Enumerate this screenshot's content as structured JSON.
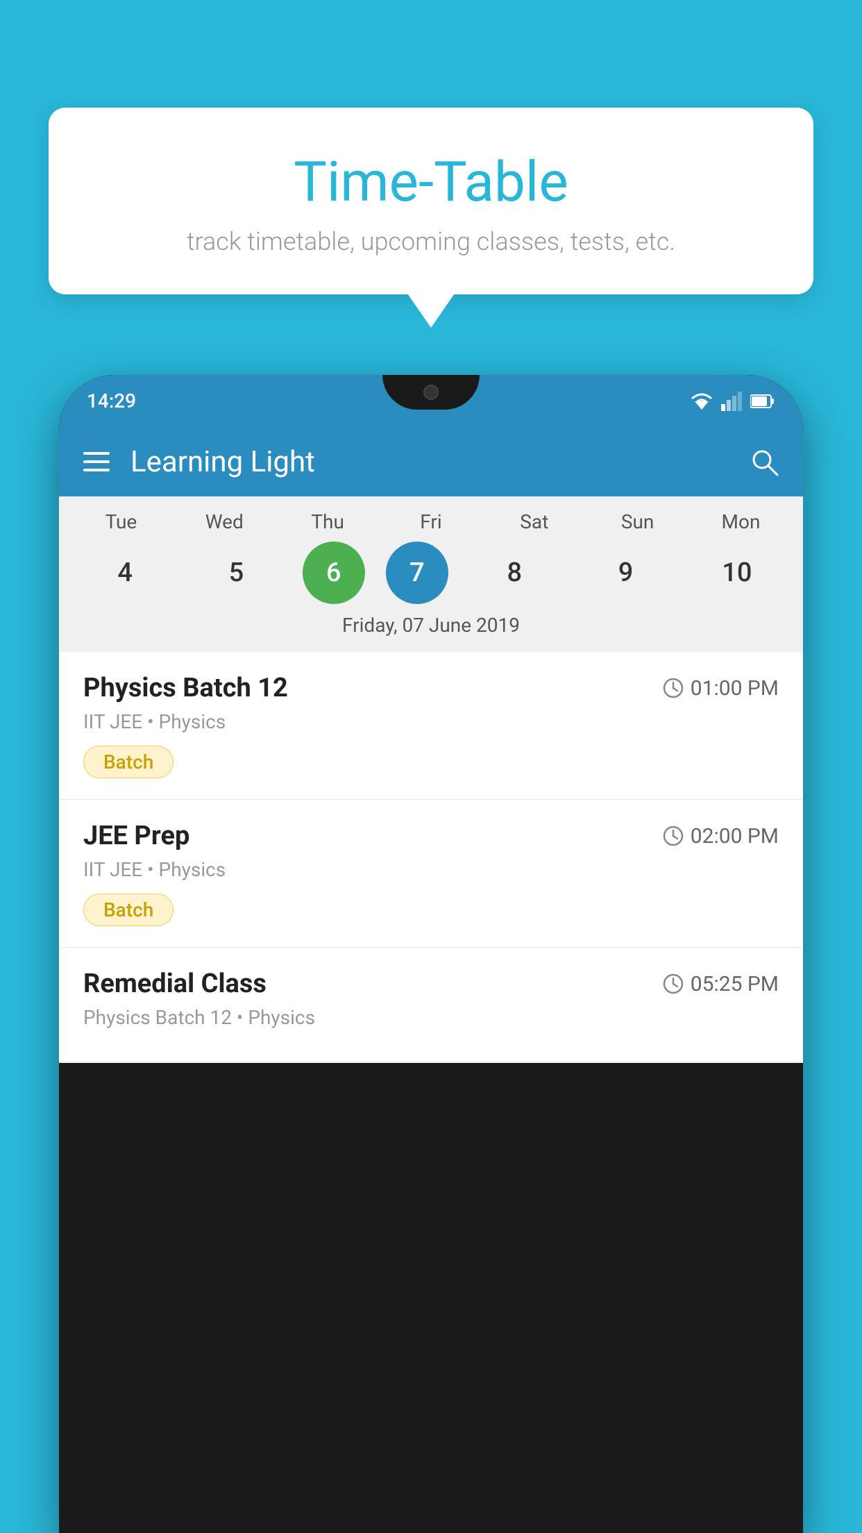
{
  "background": {
    "color": "#29b6d8"
  },
  "bubble": {
    "title": "Time-Table",
    "subtitle": "track timetable, upcoming classes, tests, etc."
  },
  "phone": {
    "status_bar": {
      "time": "14:29"
    },
    "app_bar": {
      "title": "Learning Light"
    },
    "calendar": {
      "days": [
        "Tue",
        "Wed",
        "Thu",
        "Fri",
        "Sat",
        "Sun",
        "Mon"
      ],
      "dates": [
        "4",
        "5",
        "6",
        "7",
        "8",
        "9",
        "10"
      ],
      "today_index": 2,
      "selected_index": 3,
      "selected_label": "Friday, 07 June 2019"
    },
    "schedule": [
      {
        "title": "Physics Batch 12",
        "time": "01:00 PM",
        "subtitle": "IIT JEE • Physics",
        "badge": "Batch"
      },
      {
        "title": "JEE Prep",
        "time": "02:00 PM",
        "subtitle": "IIT JEE • Physics",
        "badge": "Batch"
      },
      {
        "title": "Remedial Class",
        "time": "05:25 PM",
        "subtitle": "Physics Batch 12 • Physics",
        "badge": ""
      }
    ]
  }
}
